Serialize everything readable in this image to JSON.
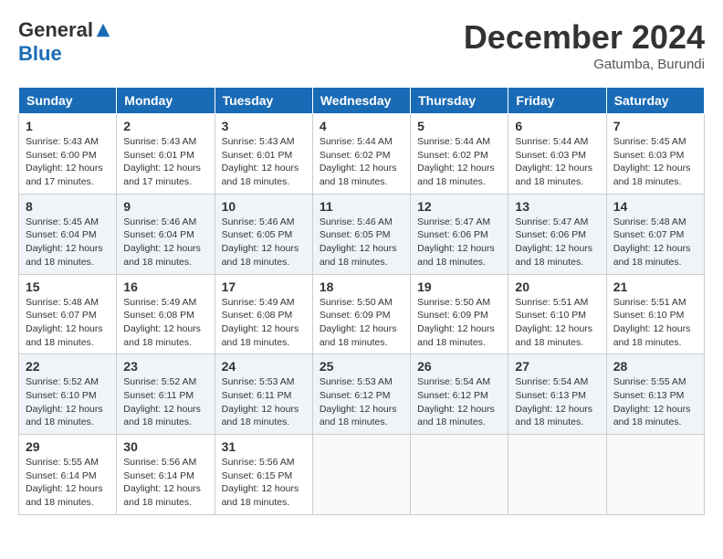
{
  "logo": {
    "general": "General",
    "blue": "Blue"
  },
  "title": "December 2024",
  "location": "Gatumba, Burundi",
  "days_of_week": [
    "Sunday",
    "Monday",
    "Tuesday",
    "Wednesday",
    "Thursday",
    "Friday",
    "Saturday"
  ],
  "weeks": [
    [
      {
        "day": "1",
        "sunrise": "5:43 AM",
        "sunset": "6:00 PM",
        "daylight": "12 hours and 17 minutes."
      },
      {
        "day": "2",
        "sunrise": "5:43 AM",
        "sunset": "6:01 PM",
        "daylight": "12 hours and 17 minutes."
      },
      {
        "day": "3",
        "sunrise": "5:43 AM",
        "sunset": "6:01 PM",
        "daylight": "12 hours and 18 minutes."
      },
      {
        "day": "4",
        "sunrise": "5:44 AM",
        "sunset": "6:02 PM",
        "daylight": "12 hours and 18 minutes."
      },
      {
        "day": "5",
        "sunrise": "5:44 AM",
        "sunset": "6:02 PM",
        "daylight": "12 hours and 18 minutes."
      },
      {
        "day": "6",
        "sunrise": "5:44 AM",
        "sunset": "6:03 PM",
        "daylight": "12 hours and 18 minutes."
      },
      {
        "day": "7",
        "sunrise": "5:45 AM",
        "sunset": "6:03 PM",
        "daylight": "12 hours and 18 minutes."
      }
    ],
    [
      {
        "day": "8",
        "sunrise": "5:45 AM",
        "sunset": "6:04 PM",
        "daylight": "12 hours and 18 minutes."
      },
      {
        "day": "9",
        "sunrise": "5:46 AM",
        "sunset": "6:04 PM",
        "daylight": "12 hours and 18 minutes."
      },
      {
        "day": "10",
        "sunrise": "5:46 AM",
        "sunset": "6:05 PM",
        "daylight": "12 hours and 18 minutes."
      },
      {
        "day": "11",
        "sunrise": "5:46 AM",
        "sunset": "6:05 PM",
        "daylight": "12 hours and 18 minutes."
      },
      {
        "day": "12",
        "sunrise": "5:47 AM",
        "sunset": "6:06 PM",
        "daylight": "12 hours and 18 minutes."
      },
      {
        "day": "13",
        "sunrise": "5:47 AM",
        "sunset": "6:06 PM",
        "daylight": "12 hours and 18 minutes."
      },
      {
        "day": "14",
        "sunrise": "5:48 AM",
        "sunset": "6:07 PM",
        "daylight": "12 hours and 18 minutes."
      }
    ],
    [
      {
        "day": "15",
        "sunrise": "5:48 AM",
        "sunset": "6:07 PM",
        "daylight": "12 hours and 18 minutes."
      },
      {
        "day": "16",
        "sunrise": "5:49 AM",
        "sunset": "6:08 PM",
        "daylight": "12 hours and 18 minutes."
      },
      {
        "day": "17",
        "sunrise": "5:49 AM",
        "sunset": "6:08 PM",
        "daylight": "12 hours and 18 minutes."
      },
      {
        "day": "18",
        "sunrise": "5:50 AM",
        "sunset": "6:09 PM",
        "daylight": "12 hours and 18 minutes."
      },
      {
        "day": "19",
        "sunrise": "5:50 AM",
        "sunset": "6:09 PM",
        "daylight": "12 hours and 18 minutes."
      },
      {
        "day": "20",
        "sunrise": "5:51 AM",
        "sunset": "6:10 PM",
        "daylight": "12 hours and 18 minutes."
      },
      {
        "day": "21",
        "sunrise": "5:51 AM",
        "sunset": "6:10 PM",
        "daylight": "12 hours and 18 minutes."
      }
    ],
    [
      {
        "day": "22",
        "sunrise": "5:52 AM",
        "sunset": "6:10 PM",
        "daylight": "12 hours and 18 minutes."
      },
      {
        "day": "23",
        "sunrise": "5:52 AM",
        "sunset": "6:11 PM",
        "daylight": "12 hours and 18 minutes."
      },
      {
        "day": "24",
        "sunrise": "5:53 AM",
        "sunset": "6:11 PM",
        "daylight": "12 hours and 18 minutes."
      },
      {
        "day": "25",
        "sunrise": "5:53 AM",
        "sunset": "6:12 PM",
        "daylight": "12 hours and 18 minutes."
      },
      {
        "day": "26",
        "sunrise": "5:54 AM",
        "sunset": "6:12 PM",
        "daylight": "12 hours and 18 minutes."
      },
      {
        "day": "27",
        "sunrise": "5:54 AM",
        "sunset": "6:13 PM",
        "daylight": "12 hours and 18 minutes."
      },
      {
        "day": "28",
        "sunrise": "5:55 AM",
        "sunset": "6:13 PM",
        "daylight": "12 hours and 18 minutes."
      }
    ],
    [
      {
        "day": "29",
        "sunrise": "5:55 AM",
        "sunset": "6:14 PM",
        "daylight": "12 hours and 18 minutes."
      },
      {
        "day": "30",
        "sunrise": "5:56 AM",
        "sunset": "6:14 PM",
        "daylight": "12 hours and 18 minutes."
      },
      {
        "day": "31",
        "sunrise": "5:56 AM",
        "sunset": "6:15 PM",
        "daylight": "12 hours and 18 minutes."
      },
      null,
      null,
      null,
      null
    ]
  ]
}
